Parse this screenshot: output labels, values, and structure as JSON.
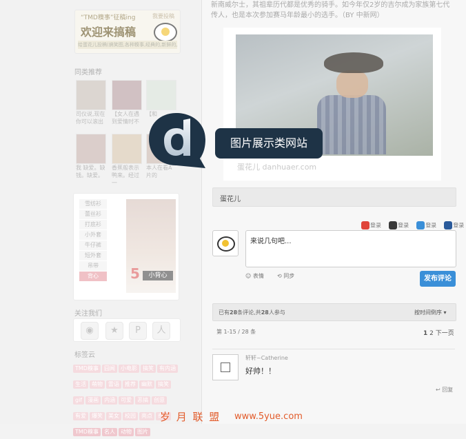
{
  "sidebar": {
    "banner": {
      "title": "“TMD糗事”征稿ing",
      "big": "欢迎来搞稿",
      "link": "我要投稿",
      "strip": "给蛋花儿投稿(搞笑图,各种糗事,经典的,新鲜的,囧的,雷的,都行)"
    },
    "related_title": "同类推荐",
    "related": [
      {
        "caption": "司仪说,现在你可以滚出",
        "color": "#c9c1b8"
      },
      {
        "caption": "【女人在遇到爱情时不",
        "color": "#b8a0a4"
      },
      {
        "caption": "【和",
        "color": "#d8e0d8"
      },
      {
        "caption": "我 缺爱。缺钱。缺爱。",
        "color": "#c8b4b0"
      },
      {
        "caption": "香蕉般表示鸭来。经过一",
        "color": "#d8c6b0"
      },
      {
        "caption": "本人在看A片的",
        "color": "#cbb8b0"
      }
    ],
    "promo": {
      "items": [
        "雪纺衫",
        "蕾丝衫",
        "打底衫",
        "小外套",
        "牛仔裤",
        "短外套",
        "吊带",
        "背心"
      ],
      "active_index": 7,
      "big_number": "5",
      "tag": "小背心"
    },
    "follow_title": "关注我们",
    "follow_icons": [
      {
        "name": "weibo-icon",
        "glyph": "◉"
      },
      {
        "name": "star-icon",
        "glyph": "★"
      },
      {
        "name": "pinterest-icon",
        "glyph": "P"
      },
      {
        "name": "renren-icon",
        "glyph": "人"
      }
    ],
    "tags_title": "标签云",
    "tags": [
      "TMD糗事",
      "囧闻",
      "小电影",
      "搞笑",
      "有内涵",
      "生活",
      "萌物",
      "雷语",
      "推荐",
      "幽默",
      "搞笑",
      "gif",
      "漫画",
      "内涵",
      "可爱",
      "恶搞",
      "创意",
      "有爱",
      "爆笑",
      "美女",
      "校园",
      "亮点",
      "奇葩",
      "TMD糗事",
      "名人",
      "动物",
      "图片"
    ]
  },
  "main": {
    "intro": "新南威尔士，其祖辈历代都是优秀的骑手。如今年仅2岁的吉尔成为家族第七代传人，也是本次参加赛马年龄最小的选手。（BY 中新网）",
    "photo_watermark": "蛋花儿 danhuaer.com",
    "author": "蛋花儿",
    "logins": [
      {
        "name": "weibo",
        "label": "登录",
        "color": "#e0453a"
      },
      {
        "name": "qq",
        "label": "登录",
        "color": "#3a3a3a"
      },
      {
        "name": "pinterest",
        "label": "登录",
        "color": "#3a8fd8"
      },
      {
        "name": "renren",
        "label": "登录",
        "color": "#2a5a9a"
      }
    ],
    "comment_placeholder": "来说几句吧...",
    "emoji_label": "表情",
    "sync_label": "同步",
    "submit_label": "发布评论",
    "stats": {
      "prefix": "已有",
      "count": "28",
      "mid": "条评论,共",
      "people": "28",
      "suffix": "人参与"
    },
    "sort_label": "按时间倒序",
    "pager_left": "第 1-15 / 28 条",
    "pager_right": {
      "p1": "1",
      "p2": "2",
      "next": "下一页"
    },
    "comment": {
      "user": "轩轩~Catherine",
      "body": "好帅！！",
      "reply": "回复"
    }
  },
  "overlay": {
    "letter": "d",
    "label": "图片展示类网站"
  },
  "footer": {
    "brand": "岁 月 联 盟",
    "url": "www.5yue.com"
  },
  "colors": {
    "accent": "#3a8fd8",
    "callout": "#1e3346",
    "tag": "#f0c8ce",
    "footer": "#e25b2a"
  }
}
